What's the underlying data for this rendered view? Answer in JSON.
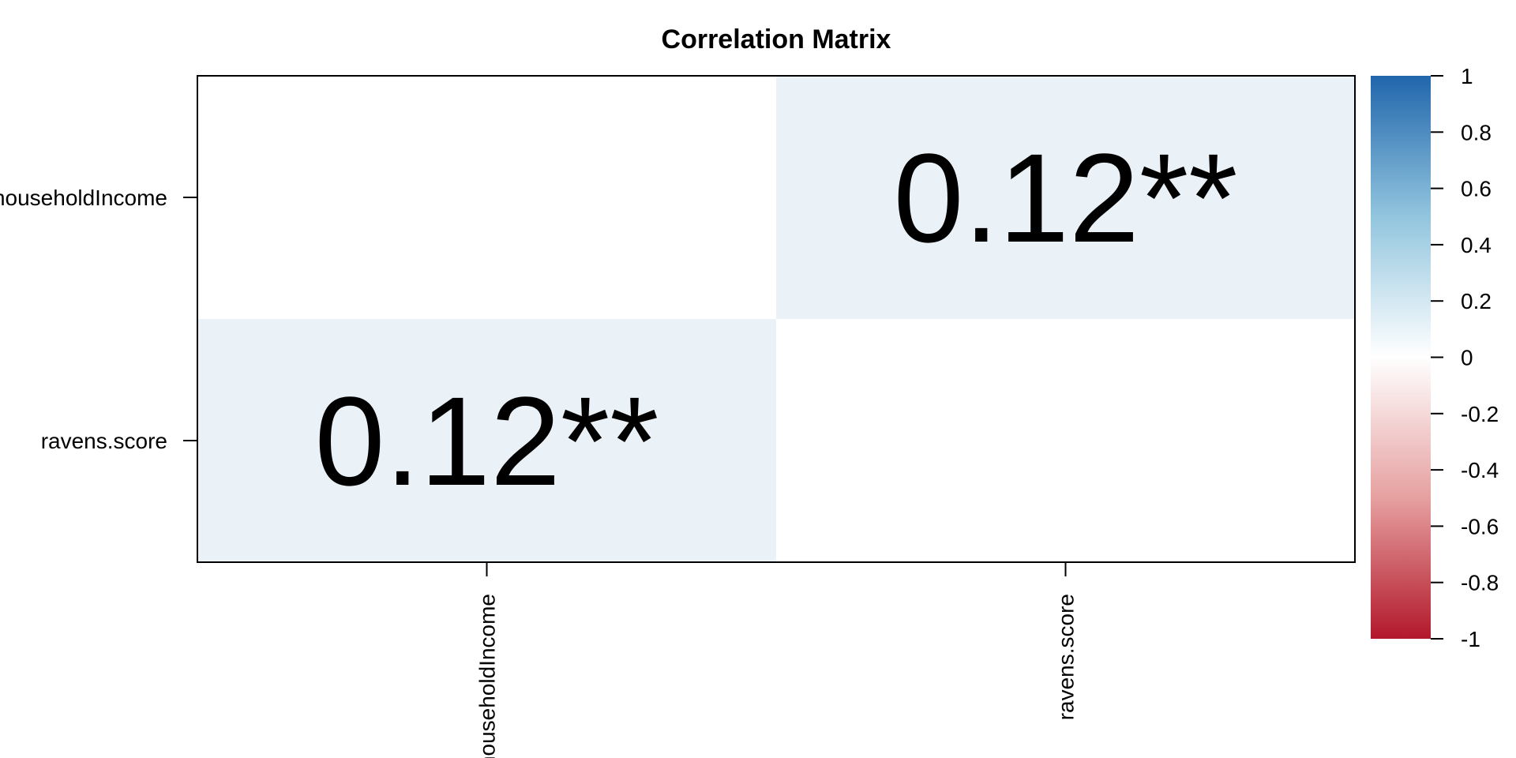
{
  "chart_data": {
    "type": "heatmap",
    "title": "Correlation Matrix",
    "rows": [
      "householdIncome",
      "ravens.score"
    ],
    "columns": [
      "householdIncome",
      "ravens.score"
    ],
    "values": [
      [
        null,
        0.12
      ],
      [
        0.12,
        null
      ]
    ],
    "cell_labels": [
      [
        "",
        "0.12**"
      ],
      [
        "0.12**",
        ""
      ]
    ],
    "colorbar": {
      "range": [
        -1,
        1
      ],
      "ticks": [
        "1",
        "0.8",
        "0.6",
        "0.4",
        "0.2",
        "0",
        "-0.2",
        "-0.4",
        "-0.6",
        "-0.8",
        "-1"
      ],
      "colors": {
        "low": "#b2182b",
        "mid": "#ffffff",
        "high": "#2166ac"
      }
    },
    "legend": "right"
  }
}
